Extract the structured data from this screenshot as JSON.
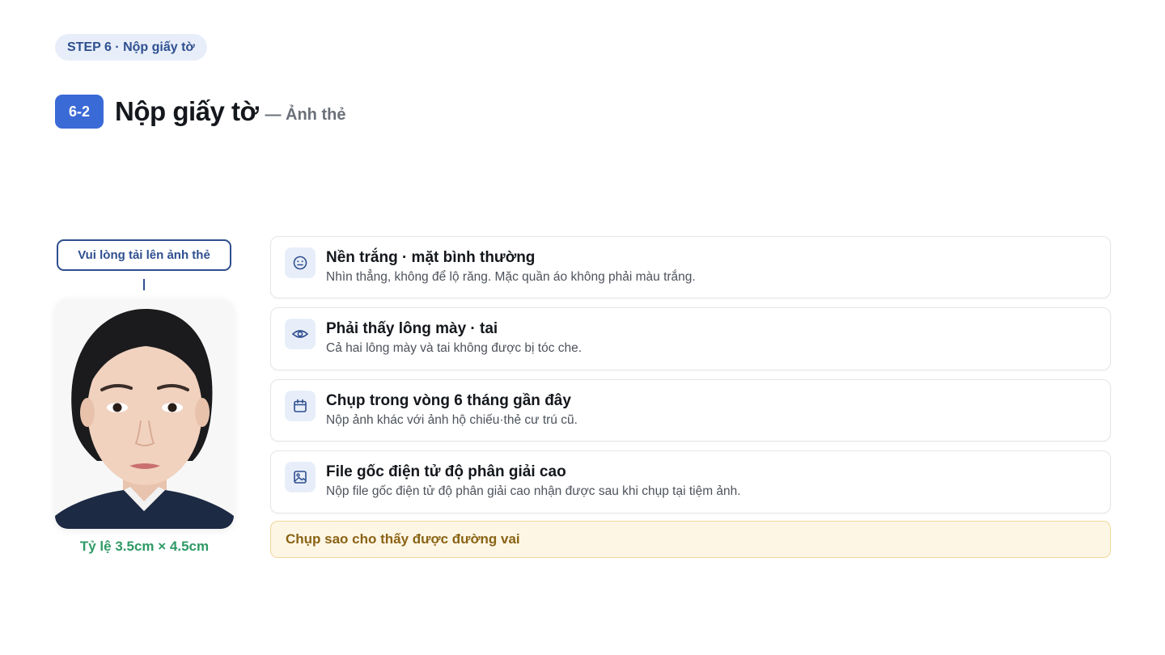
{
  "header": {
    "step_pill": "STEP 6 · Nộp giấy tờ",
    "badge": "6-2",
    "title": "Nộp giấy tờ",
    "subtitle": "— Ảnh thẻ"
  },
  "photo_panel": {
    "upload_label": "Vui lòng tải lên ảnh thẻ",
    "ratio_label": "Tỷ lệ 3.5cm × 4.5cm"
  },
  "requirements": [
    {
      "icon": "smile-face-icon",
      "title": "Nền trắng · mặt bình thường",
      "desc": "Nhìn thẳng, không để lộ răng. Mặc quần áo không phải màu trắng."
    },
    {
      "icon": "eye-icon",
      "title": "Phải thấy lông mày · tai",
      "desc": "Cả hai lông mày và tai không được bị tóc che."
    },
    {
      "icon": "calendar-icon",
      "title": "Chụp trong vòng 6 tháng gần đây",
      "desc": "Nộp ảnh khác với ảnh hộ chiếu·thẻ cư trú cũ."
    },
    {
      "icon": "image-icon",
      "title": "File gốc điện tử độ phân giải cao",
      "desc": "Nộp file gốc điện tử độ phân giải cao nhận được sau khi chụp tại tiệm ảnh."
    }
  ],
  "note": "Chụp sao cho thấy được đường vai",
  "colors": {
    "accent": "#3a6ad6",
    "navy": "#2e4f8f",
    "green": "#2e9a66",
    "note_bg": "#fdf6e5",
    "note_text": "#8a6315"
  }
}
